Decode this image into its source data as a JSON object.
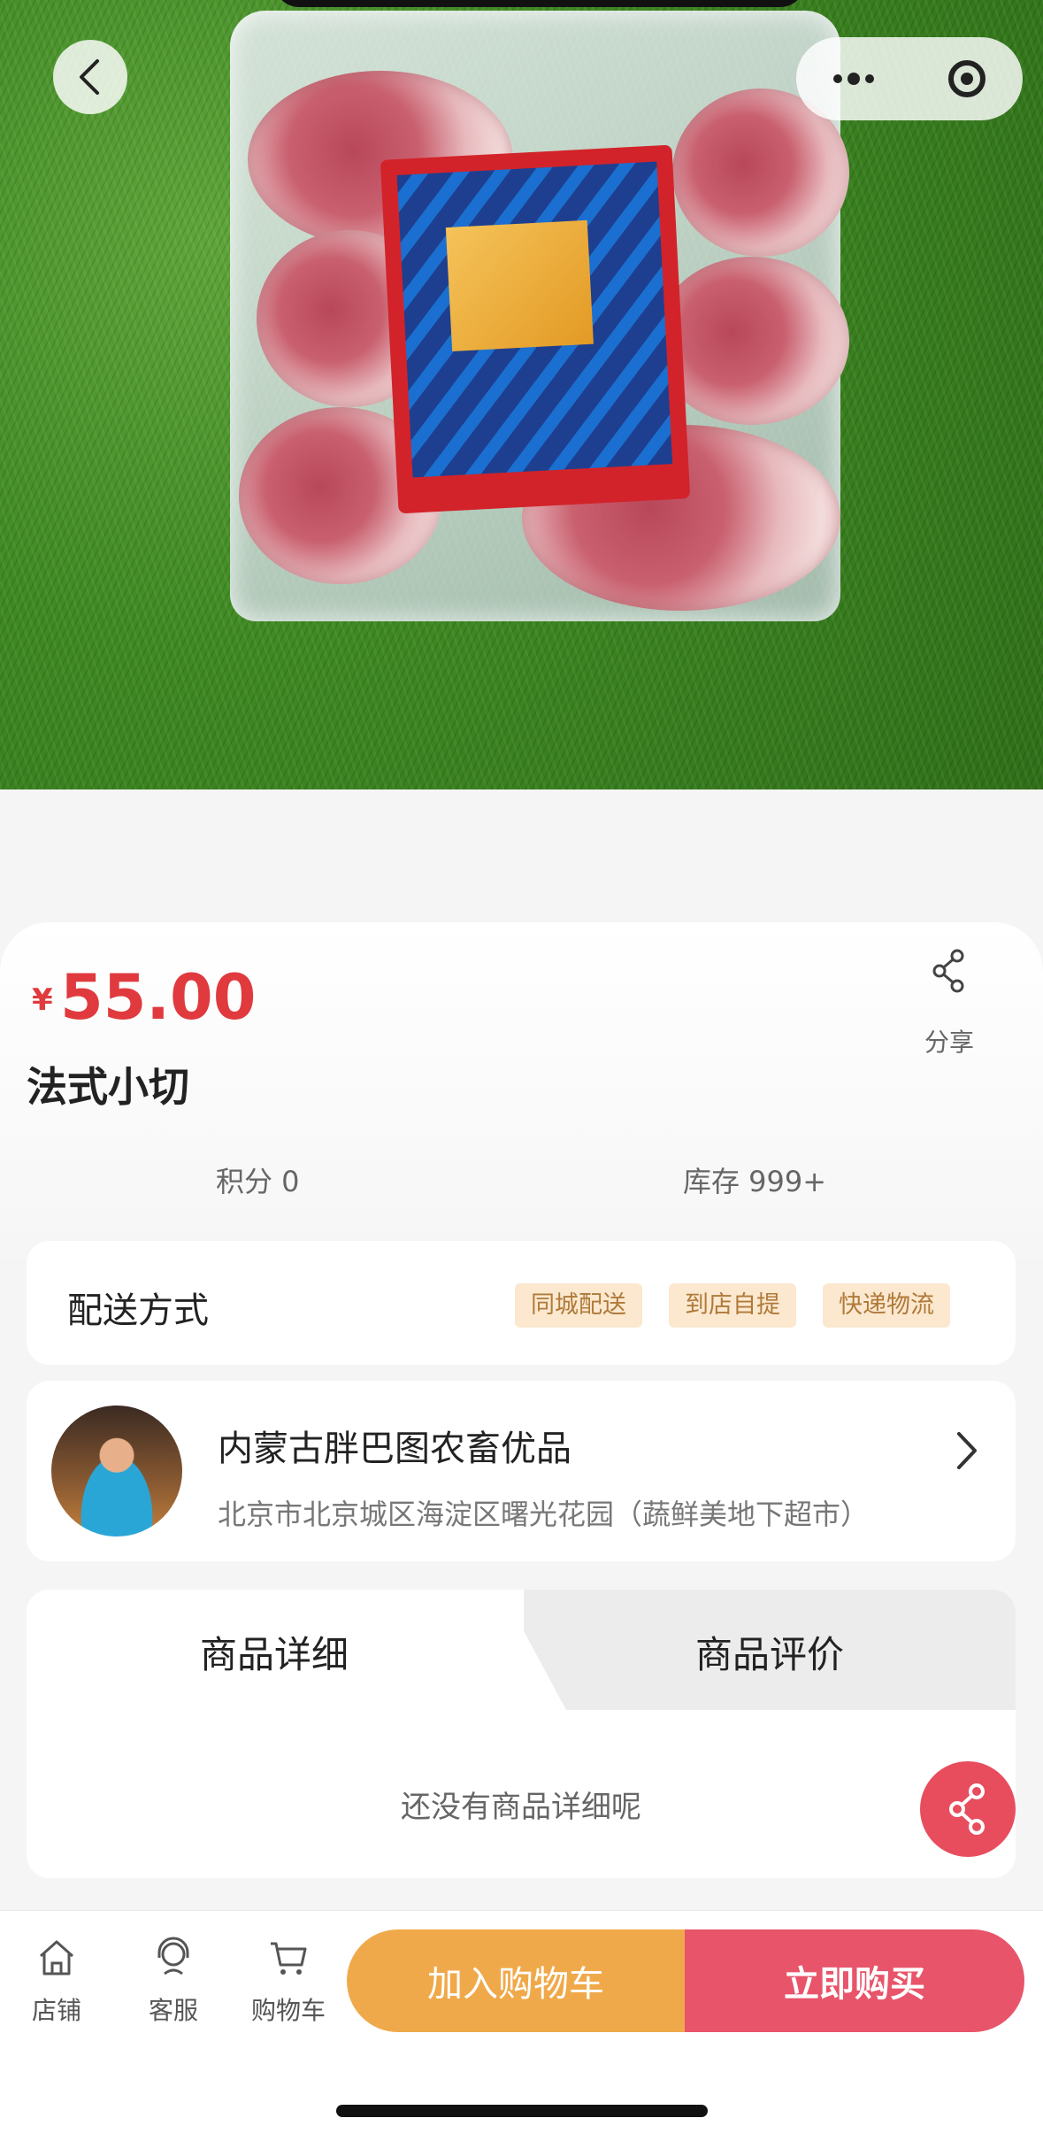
{
  "product": {
    "currency_symbol": "¥",
    "price": "55.00",
    "title": "法式小切",
    "points_label": "积分 0",
    "stock_label": "库存 999+"
  },
  "share": {
    "label": "分享"
  },
  "delivery": {
    "label": "配送方式",
    "options": [
      "同城配送",
      "到店自提",
      "快递物流"
    ]
  },
  "store": {
    "name": "内蒙古胖巴图农畜优品",
    "address": "北京市北京城区海淀区曙光花园（蔬鲜美地下超市）"
  },
  "tabs": [
    {
      "label": "商品详细",
      "active": true
    },
    {
      "label": "商品评价",
      "active": false
    }
  ],
  "detail": {
    "empty_text": "还没有商品详细呢"
  },
  "bottom_nav": [
    {
      "label": "店铺",
      "icon": "store-icon"
    },
    {
      "label": "客服",
      "icon": "customer-service-icon"
    },
    {
      "label": "购物车",
      "icon": "cart-icon"
    }
  ],
  "actions": {
    "add_to_cart": "加入购物车",
    "buy_now": "立即购买"
  },
  "colors": {
    "price": "#e03a3e",
    "add_to_cart_bg": "#f0a94a",
    "buy_now_bg": "#e8546a",
    "tag_bg": "#fbe8cf",
    "tag_text": "#b07a3a"
  }
}
